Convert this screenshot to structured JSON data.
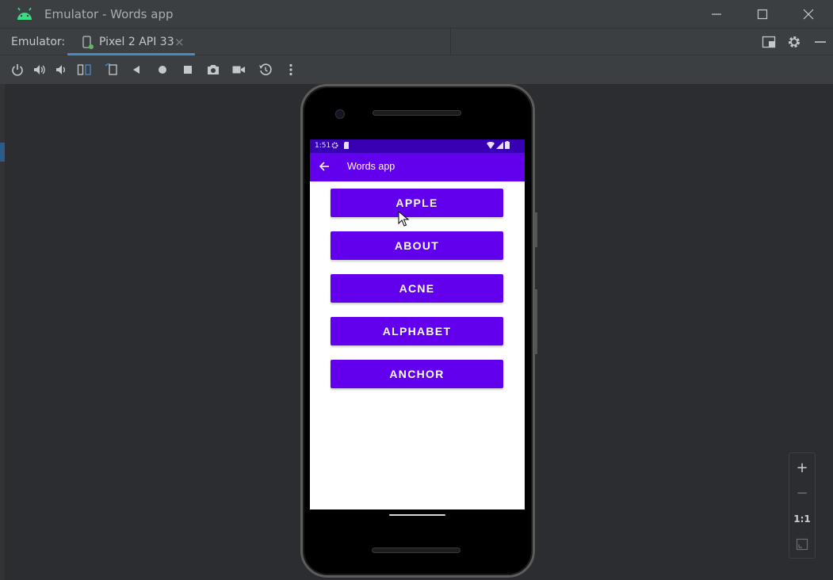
{
  "window": {
    "title": "Emulator - Words app"
  },
  "tabbar": {
    "label": "Emulator:",
    "tabs": [
      {
        "label": "Pixel 2 API 33",
        "icon": "device-icon",
        "close": "×"
      }
    ]
  },
  "toolbar": {
    "icons": [
      "power-icon",
      "volume-up-icon",
      "volume-down-icon",
      "rotate-left-icon",
      "rotate-right-icon",
      "back-icon",
      "home-icon",
      "overview-icon",
      "screenshot-icon",
      "record-icon",
      "snapshot-icon",
      "more-icon"
    ]
  },
  "device": {
    "status_bar": {
      "time": "1:51"
    },
    "app_bar": {
      "title": "Words app"
    },
    "words": [
      "APPLE",
      "ABOUT",
      "ACNE",
      "ALPHABET",
      "ANCHOR"
    ]
  },
  "zoom_controls": {
    "zoom_in": "+",
    "zoom_out": "−",
    "actual_size": "1:1"
  },
  "colors": {
    "primary": "#6200ee",
    "primary_dark": "#3700b3",
    "tab_accent": "#4a88c7"
  }
}
